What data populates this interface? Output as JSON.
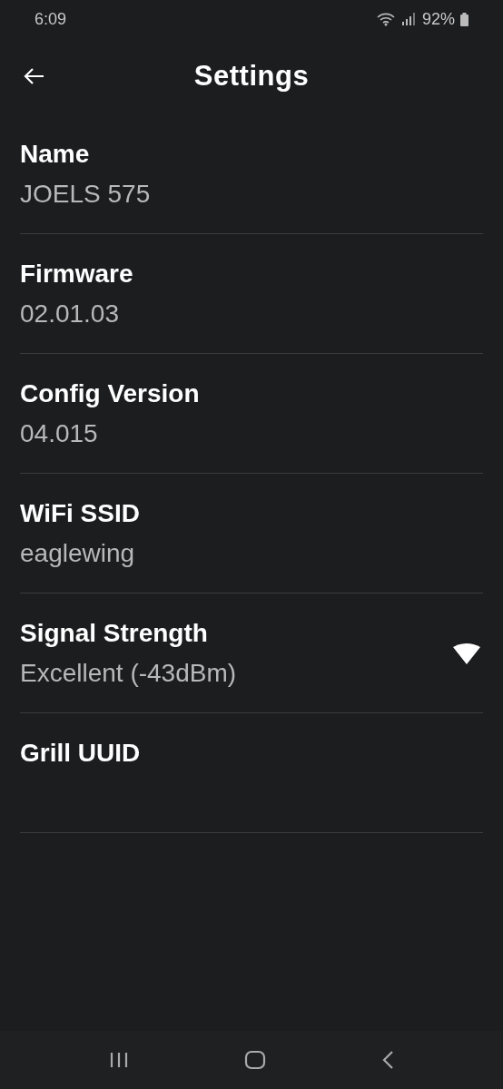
{
  "status_bar": {
    "time": "6:09",
    "battery": "92%"
  },
  "header": {
    "title": "Settings"
  },
  "rows": [
    {
      "kind": "text",
      "label": "Name",
      "value": "JOELS 575"
    },
    {
      "kind": "text",
      "label": "Firmware",
      "value": "02.01.03"
    },
    {
      "kind": "text",
      "label": "Config Version",
      "value": "04.015"
    },
    {
      "kind": "text",
      "label": "WiFi SSID",
      "value": "eaglewing"
    },
    {
      "kind": "signal",
      "label": "Signal Strength",
      "value": "Excellent (-43dBm)"
    },
    {
      "kind": "text",
      "label": "Grill UUID"
    }
  ]
}
